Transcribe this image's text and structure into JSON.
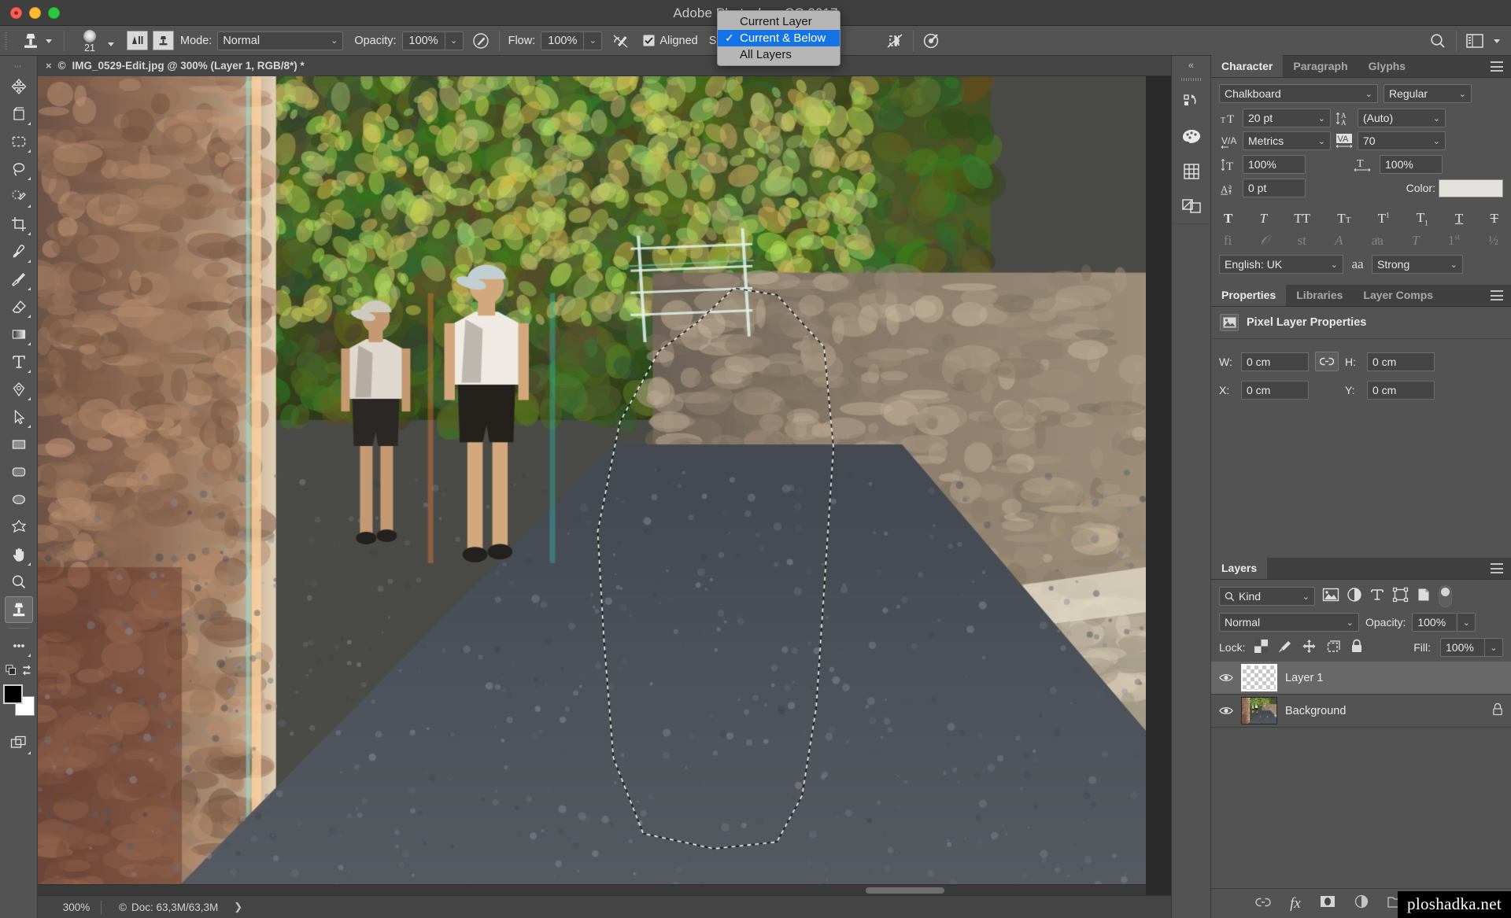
{
  "app": {
    "title": "Adobe Photoshop CC 2017",
    "window_controls": [
      "close",
      "minimize",
      "zoom"
    ]
  },
  "options_bar": {
    "tool": "clone-stamp",
    "brush_size": "21",
    "mode_label": "Mode:",
    "mode_value": "Normal",
    "opacity_label": "Opacity:",
    "opacity_value": "100%",
    "flow_label": "Flow:",
    "flow_value": "100%",
    "aligned_label": "Aligned",
    "aligned_checked": true,
    "sample_label": "Sample:",
    "search_icon": "search-icon",
    "workspace_icon": "workspace-icon"
  },
  "sample_dropdown": {
    "items": [
      {
        "label": "Current Layer",
        "selected": false
      },
      {
        "label": "Current & Below",
        "selected": true
      },
      {
        "label": "All Layers",
        "selected": false
      }
    ],
    "check_glyph": "✓"
  },
  "toolbar": {
    "tools": [
      {
        "name": "move-tool",
        "active": false
      },
      {
        "name": "artboard-tool",
        "active": false
      },
      {
        "name": "rectangular-marquee-tool",
        "active": false
      },
      {
        "name": "lasso-tool",
        "active": false
      },
      {
        "name": "quick-selection-tool",
        "active": false
      },
      {
        "name": "crop-tool",
        "active": false
      },
      {
        "name": "eyedropper-tool",
        "active": false
      },
      {
        "name": "brush-tool",
        "active": false
      },
      {
        "name": "eraser-tool",
        "active": false
      },
      {
        "name": "gradient-tool",
        "active": false
      },
      {
        "name": "type-tool",
        "active": false
      },
      {
        "name": "pen-tool",
        "active": false
      },
      {
        "name": "path-selection-tool",
        "active": false
      },
      {
        "name": "rectangle-tool",
        "active": false
      },
      {
        "name": "rounded-rectangle-tool",
        "active": false
      },
      {
        "name": "ellipse-tool",
        "active": false
      },
      {
        "name": "custom-shape-tool",
        "active": false
      },
      {
        "name": "hand-tool",
        "active": false
      },
      {
        "name": "zoom-tool",
        "active": false
      },
      {
        "name": "clone-stamp-tool",
        "active": true
      },
      {
        "name": "more-tools",
        "active": false
      }
    ],
    "foreground_color": "#000000",
    "background_color": "#ffffff"
  },
  "document": {
    "tab_title": "IMG_0529-Edit.jpg @ 300% (Layer 1, RGB/8*) *",
    "close_glyph": "×",
    "copyright_glyph": "©"
  },
  "status_bar": {
    "zoom": "300%",
    "doc_label": "Doc: 63,3M/63,3M",
    "doc_glyph": "©",
    "arrow_glyph": "❯"
  },
  "dock_strip": {
    "collapse_glyph": "«",
    "icons": [
      "history-icon",
      "color-palette-icon",
      "swatches-grid-icon",
      "adjustments-icon"
    ]
  },
  "character_panel": {
    "tabs": [
      {
        "label": "Character",
        "active": true
      },
      {
        "label": "Paragraph",
        "active": false
      },
      {
        "label": "Glyphs",
        "active": false
      }
    ],
    "font_family": "Chalkboard",
    "font_style": "Regular",
    "font_size": "20 pt",
    "leading": "(Auto)",
    "kerning": "Metrics",
    "tracking": "70",
    "vertical_scale": "100%",
    "horizontal_scale": "100%",
    "baseline_shift": "0 pt",
    "color_label": "Color:",
    "color_value": "#e4e2dc",
    "style_buttons": [
      "bold",
      "italic",
      "all-caps",
      "small-caps",
      "superscript",
      "subscript",
      "underline",
      "strikethrough"
    ],
    "opentype_buttons": [
      "standard-ligatures",
      "contextual-alternates",
      "discretionary-ligatures",
      "swash",
      "oldstyle",
      "titling-alternates",
      "ordinals",
      "fractions"
    ],
    "language": "English: UK",
    "antialias_label": "aa",
    "antialias": "Strong"
  },
  "properties_panel": {
    "tabs": [
      {
        "label": "Properties",
        "active": true
      },
      {
        "label": "Libraries",
        "active": false
      },
      {
        "label": "Layer Comps",
        "active": false
      }
    ],
    "header": "Pixel Layer Properties",
    "header_icon": "pixel-layer-icon",
    "fields": [
      {
        "label": "W:",
        "value": "0 cm"
      },
      {
        "label": "H:",
        "value": "0 cm"
      },
      {
        "label": "X:",
        "value": "0 cm"
      },
      {
        "label": "Y:",
        "value": "0 cm"
      }
    ],
    "link_icon": "link-icon"
  },
  "layers_panel": {
    "tabs": [
      {
        "label": "Layers",
        "active": true
      }
    ],
    "filter_label": "Kind",
    "filter_icons": [
      "filter-pixel-icon",
      "filter-adjustment-icon",
      "filter-type-icon",
      "filter-shape-icon",
      "filter-smart-object-icon"
    ],
    "blend_mode": "Normal",
    "opacity_label": "Opacity:",
    "opacity_value": "100%",
    "lock_label": "Lock:",
    "lock_icons": [
      "lock-transparent-pixels-icon",
      "lock-image-pixels-icon",
      "lock-position-icon",
      "lock-artboard-icon",
      "lock-all-icon"
    ],
    "fill_label": "Fill:",
    "fill_value": "100%",
    "layers": [
      {
        "name": "Layer 1",
        "visible": true,
        "selected": true,
        "locked": false,
        "thumb": "transparent"
      },
      {
        "name": "Background",
        "visible": true,
        "selected": false,
        "locked": true,
        "thumb": "photo"
      }
    ],
    "footer_icons": [
      "link-layers-icon",
      "layer-style-fx-icon",
      "layer-mask-icon",
      "adjustment-layer-icon",
      "new-group-icon",
      "new-layer-icon",
      "delete-layer-icon"
    ],
    "fx_label": "fx"
  },
  "watermark": {
    "text": "ploshadka.net"
  }
}
